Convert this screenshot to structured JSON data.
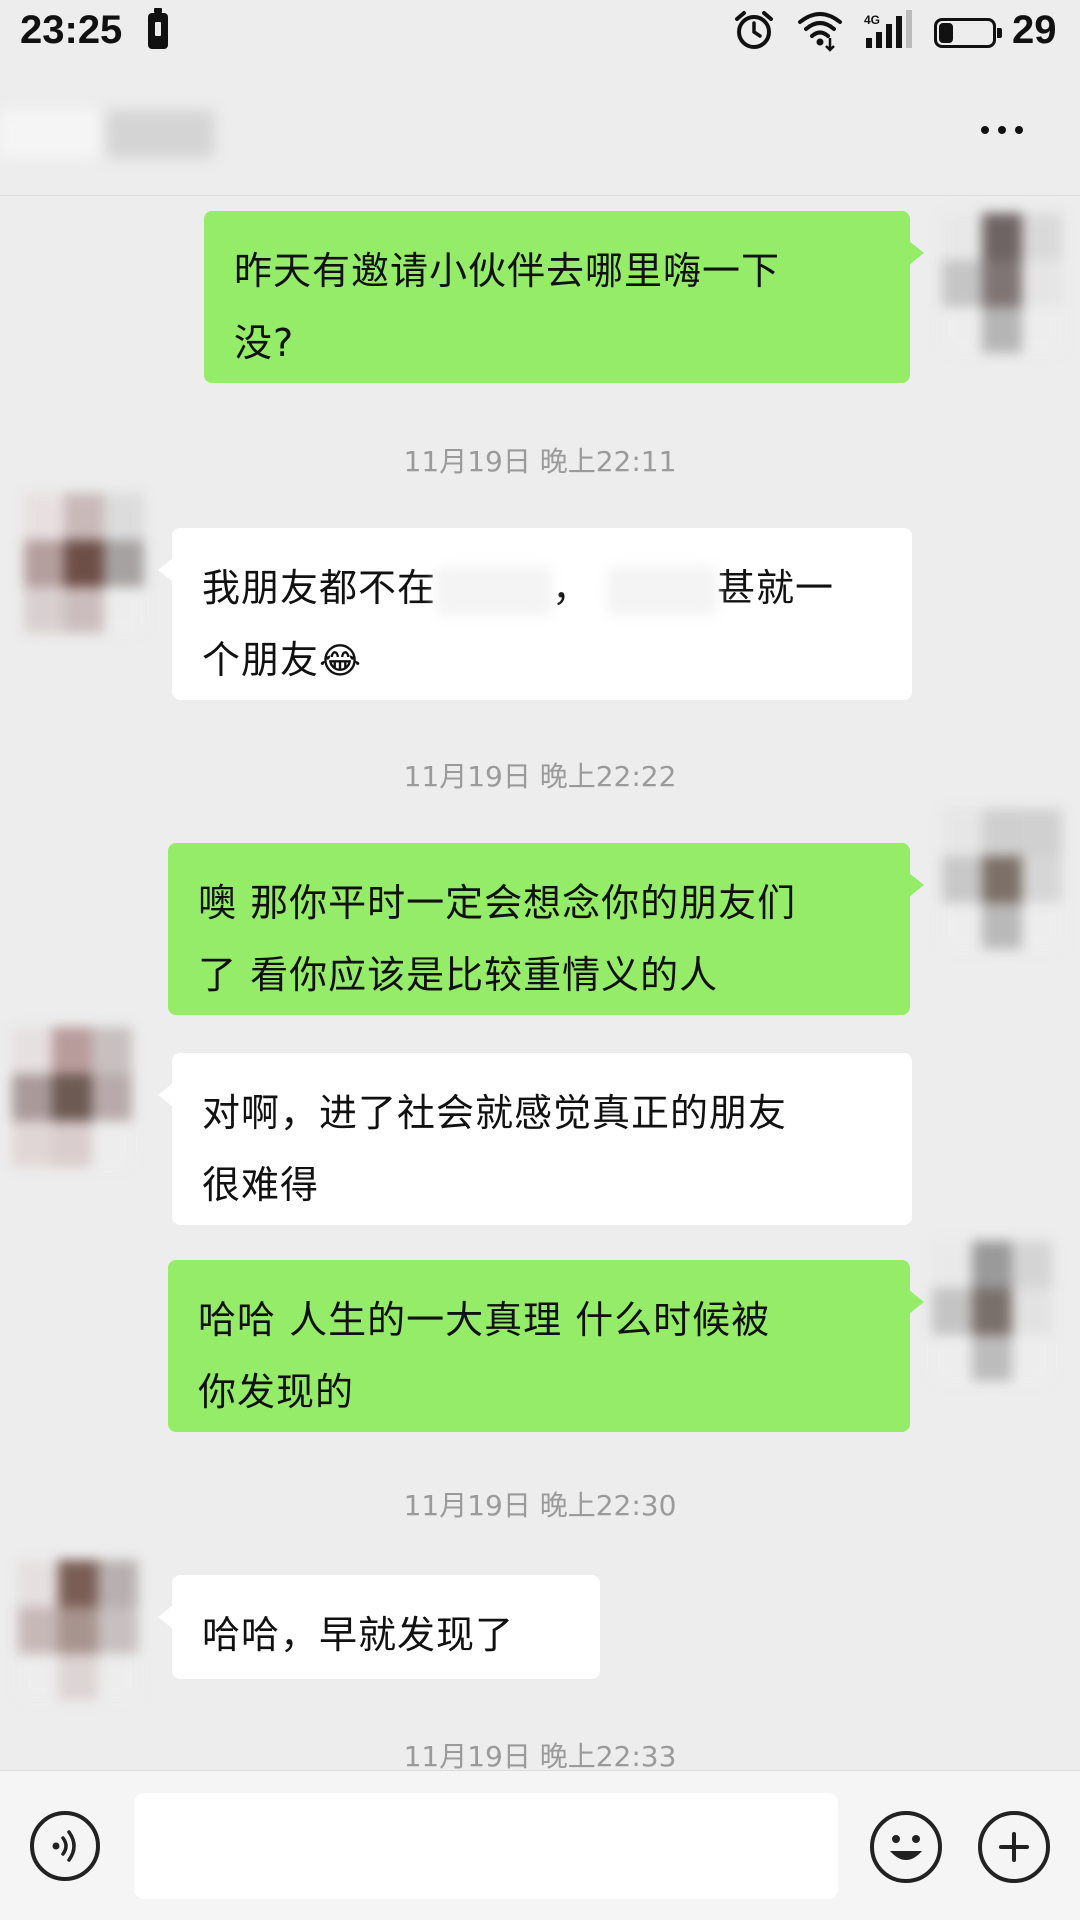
{
  "status_bar": {
    "time": "23:25",
    "network_type": "4G",
    "battery_level": "29",
    "battery_fraction": 0.29,
    "icons": [
      "battery-saver-icon",
      "alarm-icon",
      "wifi-icon",
      "signal-icon",
      "battery-icon"
    ]
  },
  "header": {
    "contact_name": "",
    "more_icon": "more-dots-icon"
  },
  "messages": [
    {
      "side": "sent",
      "lines": [
        "昨天有邀请小伙伴去哪里嗨一下",
        "没?"
      ]
    },
    {
      "type": "timestamp",
      "text": "11月19日 晚上22:11"
    },
    {
      "side": "received",
      "lines": [
        "我朋友都不在",
        "，",
        "甚就一",
        "个朋友"
      ],
      "emoji": "😂",
      "redacted": true
    },
    {
      "type": "timestamp",
      "text": "11月19日 晚上22:22"
    },
    {
      "side": "sent",
      "lines": [
        "噢 那你平时一定会想念你的朋友们",
        "了 看你应该是比较重情义的人"
      ]
    },
    {
      "side": "received",
      "lines": [
        "对啊，进了社会就感觉真正的朋友",
        "很难得"
      ]
    },
    {
      "side": "sent",
      "lines": [
        "哈哈 人生的一大真理 什么时候被",
        "你发现的"
      ]
    },
    {
      "type": "timestamp",
      "text": "11月19日 晚上22:30"
    },
    {
      "side": "received",
      "lines": [
        "哈哈，早就发现了"
      ]
    },
    {
      "type": "timestamp",
      "text": "11月19日 晚上22:33"
    }
  ],
  "input_bar": {
    "placeholder": "",
    "icons": [
      "voice-icon",
      "emoji-icon",
      "plus-icon"
    ]
  },
  "colors": {
    "background": "#ededed",
    "sent_bubble": "#95ec69",
    "received_bubble": "#ffffff",
    "timestamp": "#9a9a9a"
  }
}
